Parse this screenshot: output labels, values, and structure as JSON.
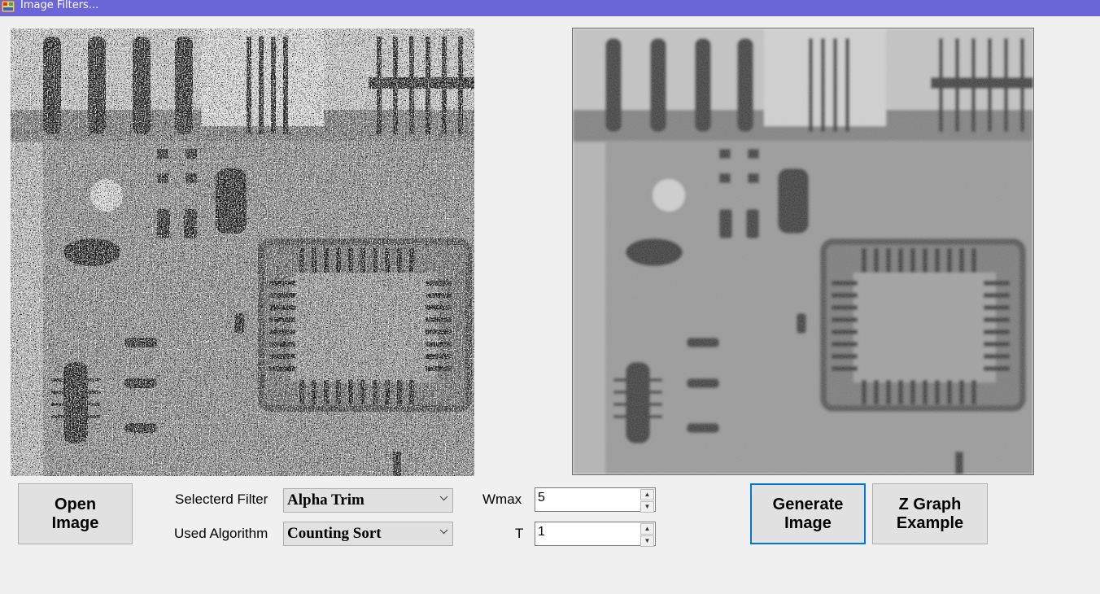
{
  "window": {
    "title": "Image Filters..."
  },
  "images": {
    "original_alt": "Noisy circuit board X-ray image",
    "filtered_alt": "Filtered circuit board X-ray image"
  },
  "buttons": {
    "open": "Open\nImage",
    "generate": "Generate\nImage",
    "zgraph": "Z Graph\nExample"
  },
  "filter": {
    "label": "Selecterd Filter",
    "value": "Alpha Trim"
  },
  "algorithm": {
    "label": "Used Algorithm",
    "value": "Counting Sort"
  },
  "wmax": {
    "label": "Wmax",
    "value": "5"
  },
  "t": {
    "label": "T",
    "value": "1"
  },
  "colors": {
    "titlebar": "#6b66d8",
    "focus": "#0078d7",
    "window": "#f0f0f0"
  }
}
